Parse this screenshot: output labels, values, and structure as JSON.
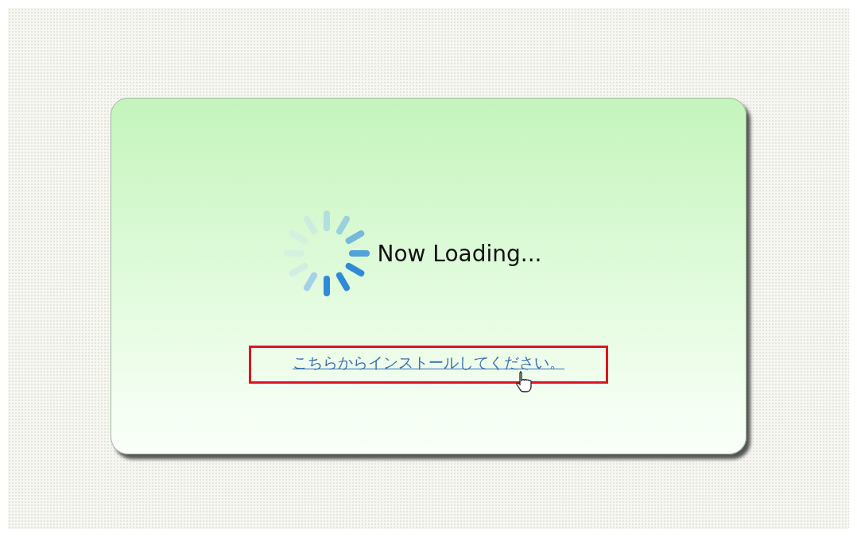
{
  "loading": {
    "text": "Now Loading..."
  },
  "install_link": {
    "text": "こちらからインストールしてください。",
    "highlighted": true
  }
}
